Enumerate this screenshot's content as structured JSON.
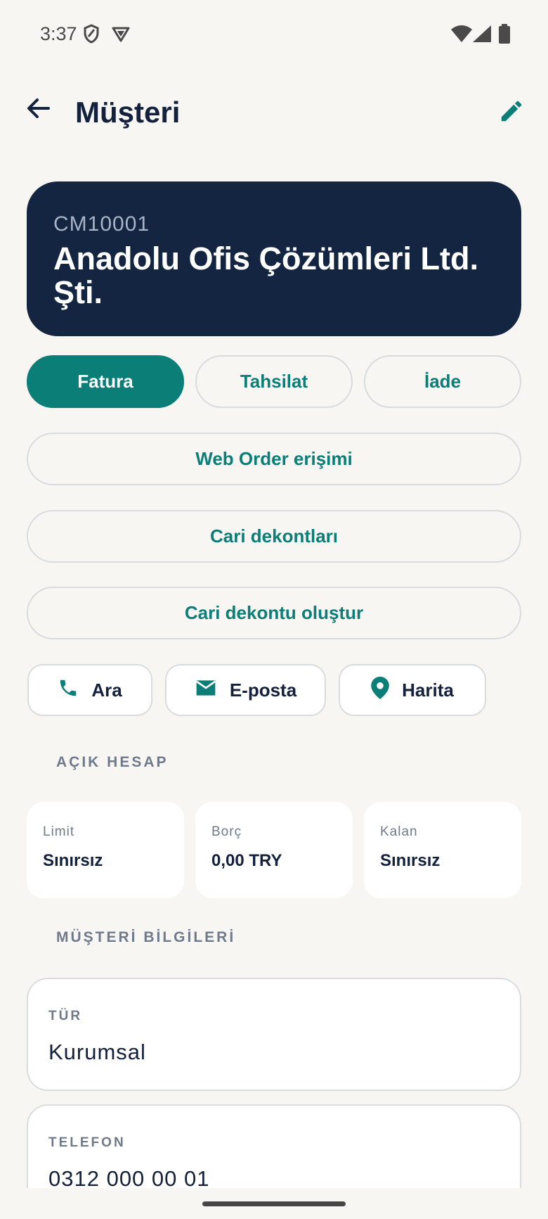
{
  "status_bar": {
    "time": "3:37",
    "icons_left": [
      "shield-icon",
      "vpn-icon"
    ],
    "icons_right": [
      "wifi-icon",
      "signal-icon",
      "battery-icon"
    ]
  },
  "app_bar": {
    "title": "Müşteri",
    "back_icon": "arrow-back-icon",
    "edit_icon": "pencil-icon"
  },
  "customer": {
    "code": "CM10001",
    "name": "Anadolu Ofis Çözümleri Ltd. Şti."
  },
  "actions": {
    "invoice": "Fatura",
    "collection": "Tahsilat",
    "return": "İade",
    "web_order": "Web Order erişimi",
    "receipts": "Cari dekontları",
    "create_receipt": "Cari dekontu oluştur"
  },
  "contact": {
    "call": "Ara",
    "email": "E-posta",
    "map": "Harita"
  },
  "open_account": {
    "section_title": "AÇIK HESAP",
    "limit_label": "Limit",
    "limit_value": "Sınırsız",
    "debt_label": "Borç",
    "debt_value": "0,00 TRY",
    "remaining_label": "Kalan",
    "remaining_value": "Sınırsız"
  },
  "customer_info": {
    "section_title": "MÜŞTERİ BİLGİLERİ",
    "type_label": "TÜR",
    "type_value": "Kurumsal",
    "phone_label": "TELEFON",
    "phone_value": "0312 000 00 01"
  },
  "colors": {
    "accent": "#0b7e78",
    "navy": "#132541",
    "background": "#f7f6f2"
  }
}
